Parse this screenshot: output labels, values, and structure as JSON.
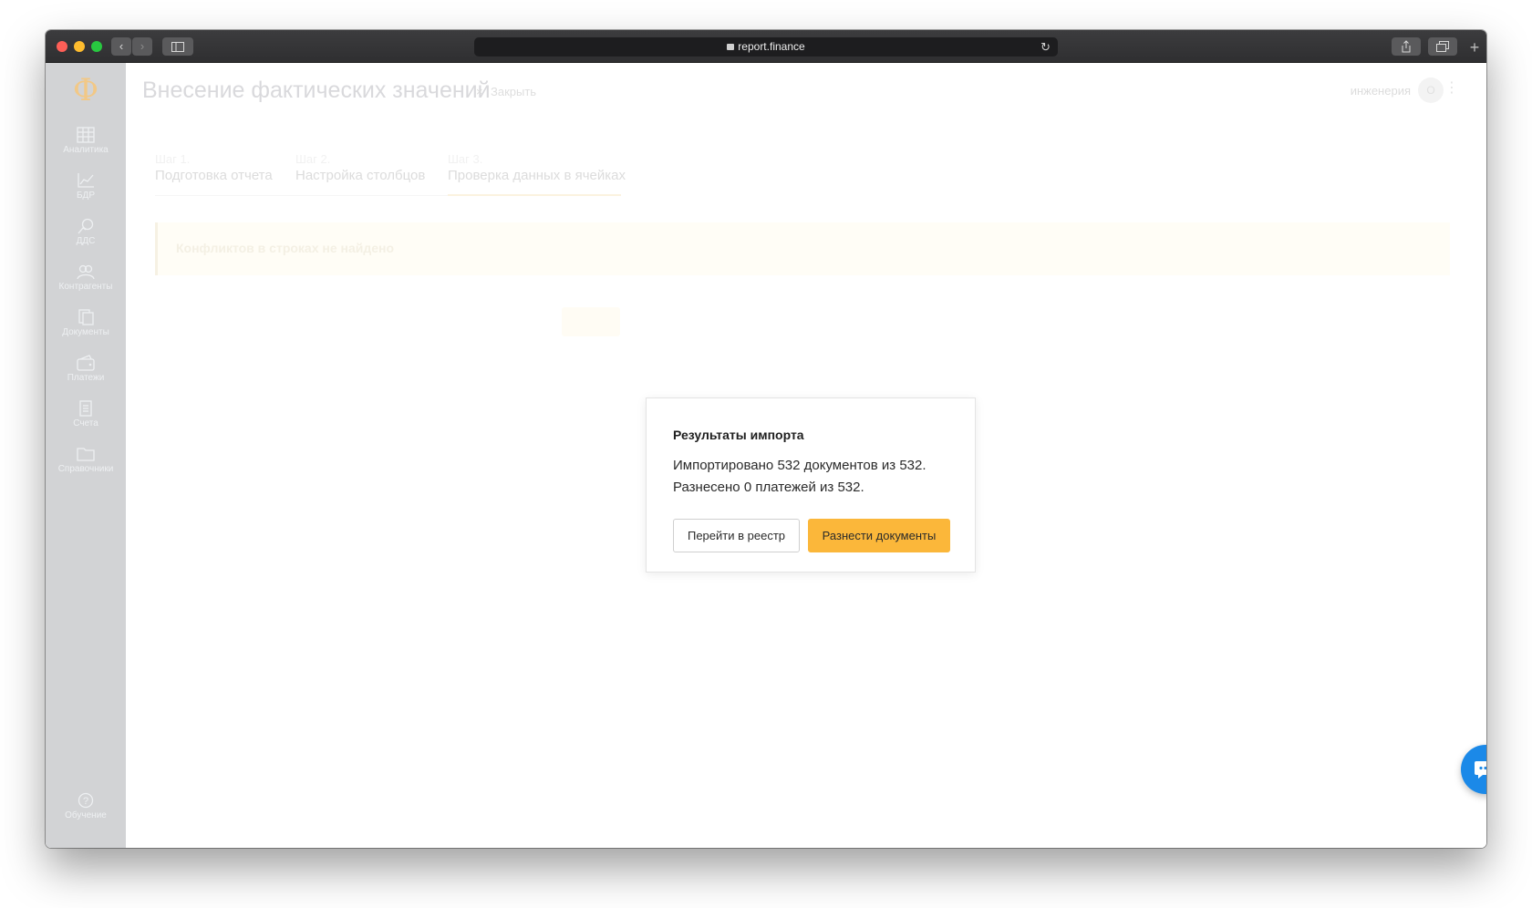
{
  "browser": {
    "url": "report.finance"
  },
  "app": {
    "logo": "Ф",
    "sidebar": {
      "items": [
        {
          "label": "Аналитика",
          "icon": "table-icon"
        },
        {
          "label": "БДР",
          "icon": "chart-icon"
        },
        {
          "label": "ДДС",
          "icon": "money-flow-icon"
        },
        {
          "label": "Контрагенты",
          "icon": "people-icon"
        },
        {
          "label": "Документы",
          "icon": "documents-icon"
        },
        {
          "label": "Платежи",
          "icon": "wallet-icon"
        },
        {
          "label": "Счета",
          "icon": "invoice-icon"
        },
        {
          "label": "Справочники",
          "icon": "folder-icon"
        }
      ],
      "help": {
        "label": "Обучение",
        "icon": "question-icon"
      }
    },
    "header": {
      "title": "Внесение фактических значений",
      "close_symbol": "×",
      "close_label": "Закрыть",
      "user_label": "инженерия",
      "avatar_initial": "О",
      "menu_symbol": "⋮"
    },
    "steps": [
      {
        "num": "Шаг 1.",
        "name": "Подготовка отчета"
      },
      {
        "num": "Шаг 2.",
        "name": "Настройка столбцов"
      },
      {
        "num": "Шаг 3.",
        "name": "Проверка данных в ячейках"
      }
    ],
    "alert": "Конфликтов в строках не найдено",
    "modal": {
      "title": "Результаты импорта",
      "line1": "Импортировано 532 документов из 532.",
      "line2": "Разнесено 0 платежей из 532.",
      "btn_registry": "Перейти в реестр",
      "btn_post": "Разнести документы"
    }
  },
  "colors": {
    "accent": "#fbb73a",
    "chat": "#1b89e8",
    "sidebar": "#d2d3d5"
  }
}
